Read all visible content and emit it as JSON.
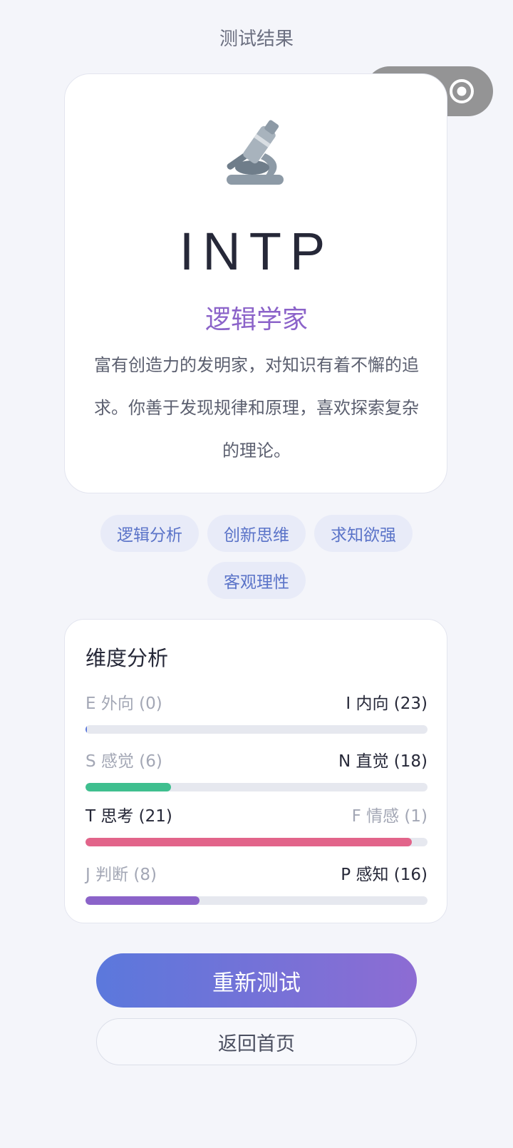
{
  "header": {
    "title": "测试结果"
  },
  "capsule": {
    "more_icon": "more-dots-icon",
    "close_icon": "target-circle-icon"
  },
  "result": {
    "icon": "microscope-icon",
    "type_code": "INTP",
    "type_name": "逻辑学家",
    "description": "富有创造力的发明家，对知识有着不懈的追求。你善于发现规律和原理，喜欢探索复杂的理论。",
    "accent_color": "#8b63c9"
  },
  "tags": [
    "逻辑分析",
    "创新思维",
    "求知欲强",
    "客观理性"
  ],
  "dimensions": {
    "title": "维度分析",
    "items": [
      {
        "left_label": "E 外向 (0)",
        "right_label": "I 内向 (23)",
        "left_score": 0,
        "right_score": 23,
        "fill_fraction": 0.0,
        "dominant": "right",
        "color": "#5b78dc"
      },
      {
        "left_label": "S 感觉 (6)",
        "right_label": "N 直觉 (18)",
        "left_score": 6,
        "right_score": 18,
        "fill_fraction": 0.25,
        "dominant": "right",
        "color": "#3fbf8f"
      },
      {
        "left_label": "T 思考 (21)",
        "right_label": "F 情感 (1)",
        "left_score": 21,
        "right_score": 1,
        "fill_fraction": 0.955,
        "dominant": "left",
        "color": "#e2648a"
      },
      {
        "left_label": "J 判断 (8)",
        "right_label": "P 感知 (16)",
        "left_score": 8,
        "right_score": 16,
        "fill_fraction": 0.333,
        "dominant": "right",
        "color": "#8b63c9"
      }
    ]
  },
  "actions": {
    "retest_label": "重新测试",
    "home_label": "返回首页"
  }
}
